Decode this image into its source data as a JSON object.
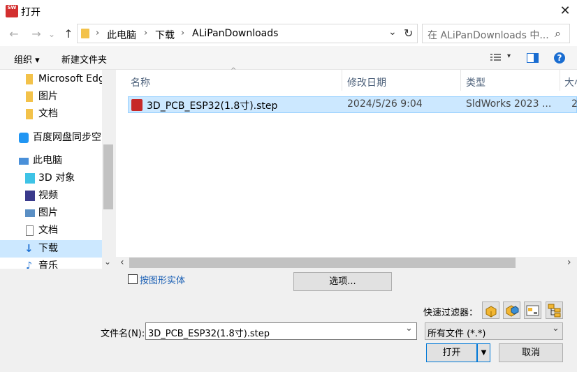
{
  "window": {
    "title": "打开",
    "close_glyph": "✕",
    "app_icon_text": "SW"
  },
  "nav": {
    "back_glyph": "←",
    "forward_glyph": "→",
    "recent_glyph": "⌄",
    "up_glyph": "↑",
    "breadcrumb": [
      "此电脑",
      "下载",
      "ALiPanDownloads"
    ],
    "breadcrumb_sep": "›",
    "dropdown_glyph": "⌄",
    "refresh_glyph": "↻",
    "search_placeholder": "在 ALiPanDownloads 中...",
    "search_glyph": "⌕"
  },
  "toolbar": {
    "organize_label": "组织 ▾",
    "new_folder_label": "新建文件夹",
    "view_glyph": "▾",
    "help_glyph": "?"
  },
  "sidebar": {
    "items": [
      {
        "label": "Microsoft Edge",
        "icon": "folder-icon"
      },
      {
        "label": "图片",
        "icon": "folder-icon"
      },
      {
        "label": "文档",
        "icon": "folder-icon"
      },
      {
        "label": "百度网盘同步空间",
        "icon": "baidu-sync-icon"
      },
      {
        "label": "此电脑",
        "icon": "computer-icon"
      },
      {
        "label": "3D 对象",
        "icon": "3d-objects-icon"
      },
      {
        "label": "视频",
        "icon": "video-icon"
      },
      {
        "label": "图片",
        "icon": "pictures-icon"
      },
      {
        "label": "文档",
        "icon": "documents-icon"
      },
      {
        "label": "下载",
        "icon": "download-icon"
      },
      {
        "label": "音乐",
        "icon": "music-icon"
      }
    ],
    "selected_index": 9
  },
  "columns": {
    "name": "名称",
    "modified": "修改日期",
    "type": "类型",
    "size": "大小"
  },
  "files": [
    {
      "name": "3D_PCB_ESP32(1.8寸).step",
      "modified": "2024/5/26 9:04",
      "type": "SldWorks 2023 ...",
      "size": "2"
    }
  ],
  "sort_glyph": "^",
  "scroll_left_glyph": "‹",
  "scroll_right_glyph": "›",
  "scroll_down_glyph": "⌄",
  "bottom": {
    "checkbox_label": "按图形实体",
    "options_button": "选项...",
    "quick_filter_label": "快速过滤器：",
    "filename_label": "文件名(N):",
    "filename_value": "3D_PCB_ESP32(1.8寸).step",
    "filetype_value": "所有文件 (*.*)",
    "open_button": "打开",
    "cancel_button": "取消",
    "combo_glyph": "⌄",
    "split_glyph": "▼"
  },
  "colors": {
    "selection": "#cce8ff",
    "accent": "#0078d7",
    "sw_red": "#c62828"
  }
}
